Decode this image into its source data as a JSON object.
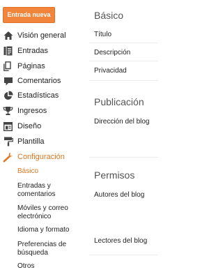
{
  "sidebar": {
    "new_post_label": "Entrada nueva",
    "items": [
      {
        "label": "Visión general",
        "icon": "home-icon"
      },
      {
        "label": "Entradas",
        "icon": "posts-icon"
      },
      {
        "label": "Páginas",
        "icon": "pages-icon"
      },
      {
        "label": "Comentarios",
        "icon": "comment-icon"
      },
      {
        "label": "Estadísticas",
        "icon": "pie-chart-icon"
      },
      {
        "label": "Ingresos",
        "icon": "trophy-icon"
      },
      {
        "label": "Diseño",
        "icon": "layout-icon"
      },
      {
        "label": "Plantilla",
        "icon": "paint-roller-icon"
      },
      {
        "label": "Configuración",
        "icon": "wrench-icon",
        "active": true
      }
    ],
    "sub_items": [
      {
        "label": "Básico",
        "active": true
      },
      {
        "label": "Entradas y comentarios"
      },
      {
        "label": "Móviles y correo electrónico"
      },
      {
        "label": "Idioma y formato"
      },
      {
        "label": "Preferencias de búsqueda"
      },
      {
        "label": "Otros"
      }
    ]
  },
  "content": {
    "sections": [
      {
        "title": "Básico",
        "settings": [
          "Título",
          "Descripción",
          "Privacidad"
        ]
      },
      {
        "title": "Publicación",
        "settings": [
          "Dirección del blog"
        ]
      },
      {
        "title": "Permisos",
        "settings": [
          "Autores del blog",
          "Lectores del blog"
        ]
      }
    ]
  },
  "colors": {
    "accent": "#f1853b",
    "active_text": "#e0761f",
    "icon": "#444444",
    "divider": "#ebebeb"
  }
}
